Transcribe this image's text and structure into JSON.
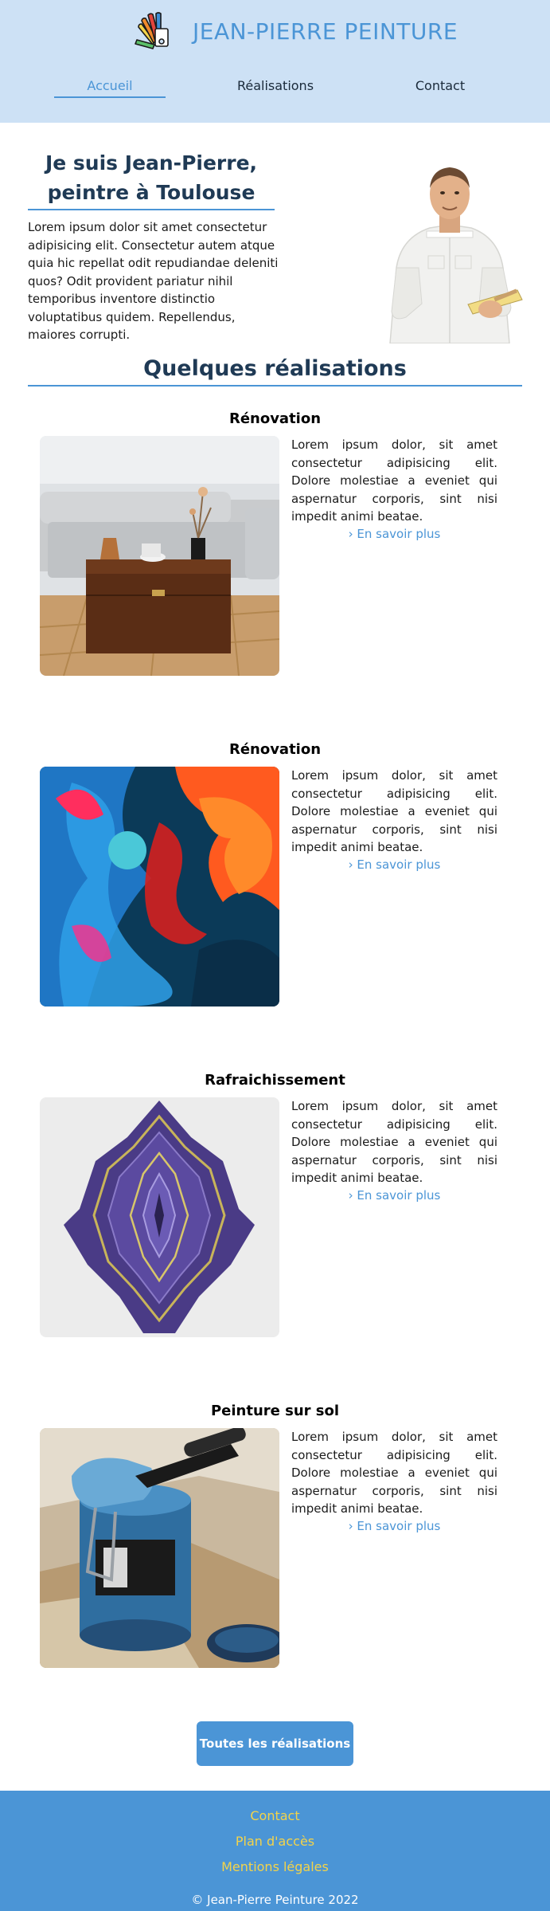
{
  "header": {
    "brand_name": "JEAN-PIERRE PEINTURE",
    "nav": [
      {
        "label": "Accueil",
        "active": true
      },
      {
        "label": "Réalisations",
        "active": false
      },
      {
        "label": "Contact",
        "active": false
      }
    ]
  },
  "intro": {
    "title": "Je suis Jean-Pierre, peintre à Toulouse",
    "text": "Lorem ipsum dolor sit amet consectetur adipisicing elit. Consectetur autem atque quia hic repellat odit repudiandae deleniti quos? Odit provident pariatur nihil temporibus inventore distinctio voluptatibus quidem. Repellendus, maiores corrupti."
  },
  "works": {
    "section_title": "Quelques réalisations",
    "items": [
      {
        "title": "Rénovation",
        "image": "living-room-photo",
        "text": "Lorem ipsum dolor, sit amet consectetur adipisicing elit. Dolore molestiae a eveniet qui aspernatur corporis, sint nisi impedit animi beatae.",
        "link": "› En savoir plus"
      },
      {
        "title": "Rénovation",
        "image": "ink-smoke-photo",
        "text": "Lorem ipsum dolor, sit amet consectetur adipisicing elit. Dolore molestiae a eveniet qui aspernatur corporis, sint nisi impedit animi beatae.",
        "link": "› En savoir plus"
      },
      {
        "title": "Rafraichissement",
        "image": "abstract-pattern-photo",
        "text": "Lorem ipsum dolor, sit amet consectetur adipisicing elit. Dolore molestiae a eveniet qui aspernatur corporis, sint nisi impedit animi beatae.",
        "link": "› En savoir plus"
      },
      {
        "title": "Peinture sur sol",
        "image": "paint-can-roller-photo",
        "text": "Lorem ipsum dolor, sit amet consectetur adipisicing elit. Dolore molestiae a eveniet qui aspernatur corporis, sint nisi impedit animi beatae.",
        "link": "› En savoir plus"
      }
    ],
    "all_button": "Toutes les réalisations"
  },
  "footer": {
    "links": [
      "Contact",
      "Plan d'accès",
      "Mentions légales"
    ],
    "copyright": "© Jean-Pierre Peinture 2022"
  },
  "colors": {
    "accent": "#4b95d6",
    "header_bg": "#cde1f5",
    "footer_link": "#f3d34a"
  }
}
